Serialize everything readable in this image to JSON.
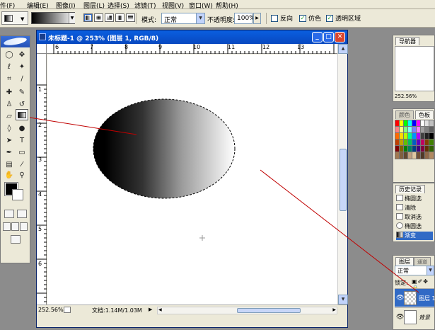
{
  "menubar": {
    "items": [
      "件(F)",
      "编辑(E)",
      "图像(I)",
      "图层(L)",
      "选择(S)",
      "滤镜(T)",
      "视图(V)",
      "窗口(W)",
      "帮助(H)"
    ]
  },
  "options": {
    "mode_label": "模式:",
    "mode_value": "正常",
    "opacity_label": "不透明度:",
    "opacity_value": "100%",
    "reverse_label": "反向",
    "dither_label": "仿色",
    "transparency_label": "透明区域",
    "dither_checked": "✓",
    "transparency_checked": "✓"
  },
  "document": {
    "title": "未标题-1 @ 253% (图层 1, RGB/8)",
    "ruler_top": [
      "6",
      "7",
      "8",
      "9",
      "10",
      "11",
      "12",
      "13"
    ],
    "ruler_left": [
      "1",
      "2",
      "3",
      "4",
      "5",
      "6"
    ],
    "zoom": "252.56%",
    "doc_info": "文档:1.14M/1.03M"
  },
  "navigator": {
    "tab": "导航器",
    "zoom": "252.56%"
  },
  "color_panel": {
    "tab_color": "颜色",
    "tab_swatches": "色板",
    "swatch_colors": [
      "#ff0000",
      "#ffff00",
      "#00ff00",
      "#00ffff",
      "#0000ff",
      "#ff00ff",
      "#ffffff",
      "#e0e0e0",
      "#c0c0c0",
      "#ff8080",
      "#ffff80",
      "#80ff80",
      "#80ffff",
      "#8080ff",
      "#ff80ff",
      "#a0a0a0",
      "#808080",
      "#606060",
      "#ff6a00",
      "#ffd800",
      "#b6ff00",
      "#00ff90",
      "#0094ff",
      "#b200ff",
      "#404040",
      "#202020",
      "#000000",
      "#c04000",
      "#c0a000",
      "#60c000",
      "#00c060",
      "#0060c0",
      "#6000c0",
      "#c00060",
      "#804000",
      "#408000",
      "#800000",
      "#806000",
      "#008000",
      "#008060",
      "#004080",
      "#400080",
      "#800040",
      "#603000",
      "#306000",
      "#a07850",
      "#806040",
      "#604830",
      "#c0a080",
      "#e0c8a0",
      "#705038",
      "#503828",
      "#906848",
      "#b08860"
    ]
  },
  "history": {
    "tab": "历史记录",
    "items": [
      "椭圆选",
      "清除",
      "取消选",
      "椭圆选",
      "渐变"
    ]
  },
  "layers": {
    "tab_layers": "图层",
    "tab_channels": "通道",
    "mode": "正常",
    "lock_label": "锁定:",
    "rows": [
      "图层 1",
      "背景"
    ]
  }
}
